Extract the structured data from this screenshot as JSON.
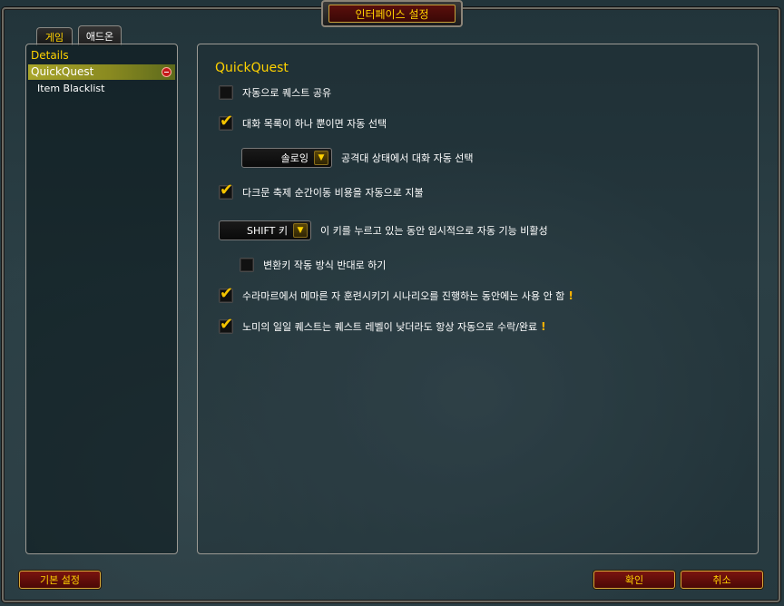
{
  "window": {
    "title": "인터페이스 설정"
  },
  "tabs": [
    {
      "label": "게임",
      "active": false
    },
    {
      "label": "애드온",
      "active": true
    }
  ],
  "sidebar": {
    "header": "Details",
    "selected": "QuickQuest",
    "items": [
      {
        "label": "Item Blacklist"
      }
    ]
  },
  "main": {
    "title": "QuickQuest",
    "options": {
      "auto_share": {
        "label": "자동으로 퀘스트 공유",
        "checked": false
      },
      "auto_select_dialog": {
        "label": "대화 목록이 하나 뿐이면 자동 선택",
        "checked": true
      },
      "group_mode": {
        "value": "솔로잉",
        "label": "공격대 상태에서 대화 자동 선택"
      },
      "darkmoon": {
        "label": "다크문 축제 순간이동 비용을 자동으로 지불",
        "checked": true
      },
      "modifier": {
        "value": "SHIFT 키",
        "label": "이 키를 누르고 있는 동안 임시적으로 자동 기능 비활성"
      },
      "reverse_modifier": {
        "label": "변환키 작동 방식 반대로 하기",
        "checked": false
      },
      "suramar": {
        "label": "수라마르에서 메마른 자 훈련시키기 시나리오를 진행하는 동안에는 사용 안 함",
        "checked": true,
        "warning": "!"
      },
      "nomi": {
        "label": "노미의 일일 퀘스트는 퀘스트 레벨이 낮더라도 항상 자동으로 수락/완료",
        "checked": true,
        "warning": "!"
      }
    }
  },
  "footer": {
    "defaults_label": "기본 설정",
    "ok_label": "확인",
    "cancel_label": "취소"
  },
  "colors": {
    "gold": "#ffd200",
    "panel_border": "#9c9a94",
    "button_red": "#7a140f"
  }
}
